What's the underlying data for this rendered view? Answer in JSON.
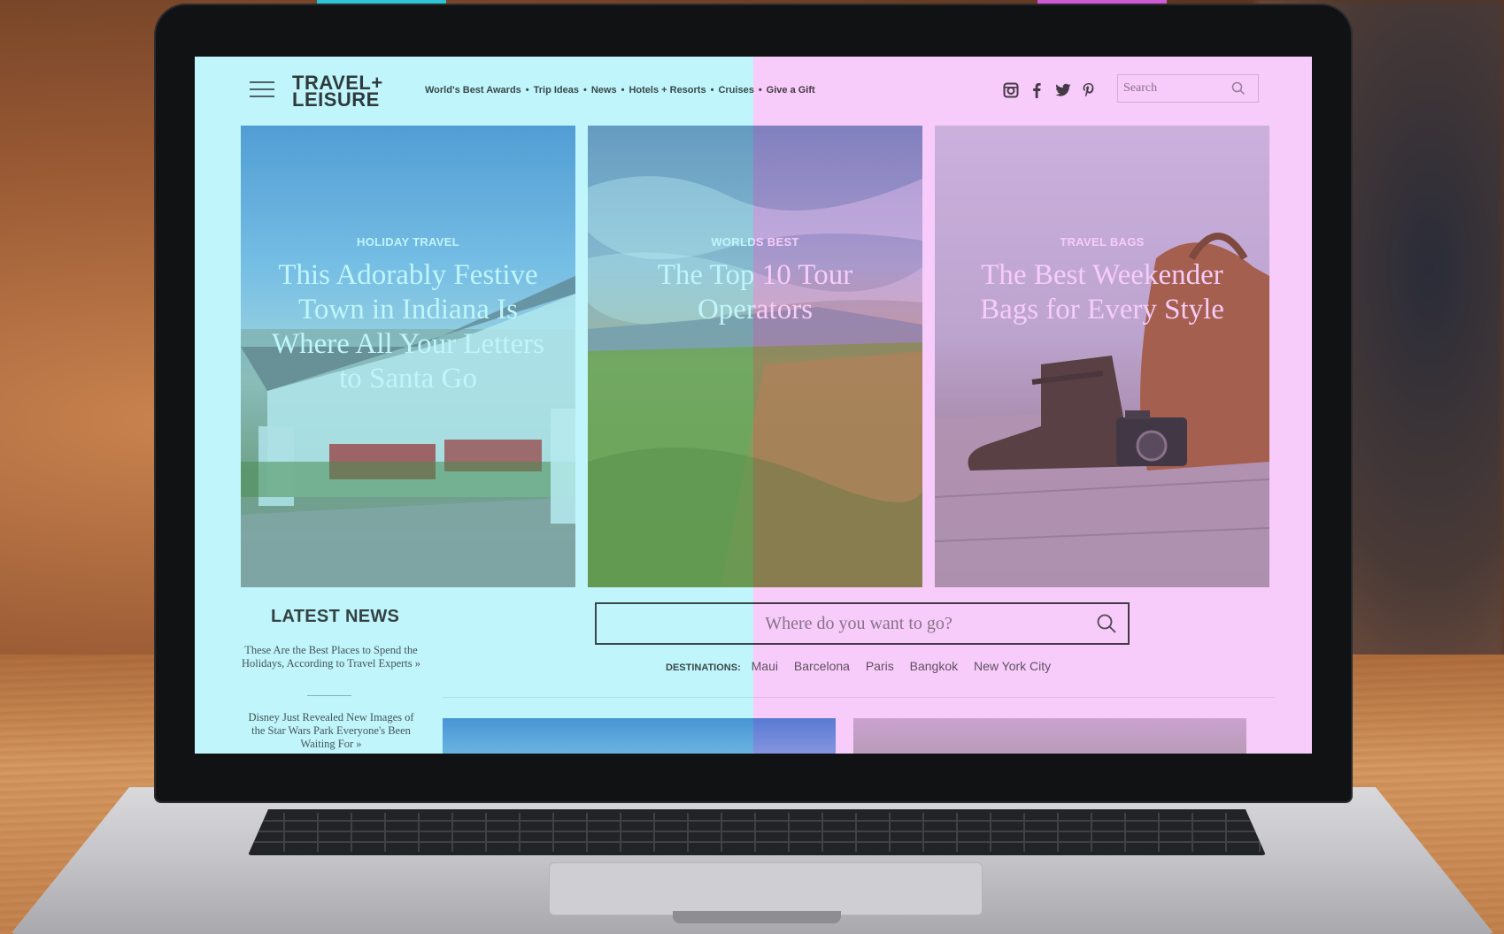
{
  "header": {
    "logo_line1": "TRAVEL+",
    "logo_line2": "LEISURE",
    "nav": [
      {
        "label": "World's Best Awards"
      },
      {
        "label": "Trip Ideas"
      },
      {
        "label": "News"
      },
      {
        "label": "Hotels + Resorts"
      },
      {
        "label": "Cruises"
      },
      {
        "label": "Give a Gift"
      }
    ],
    "nav_separator": "•",
    "social_icons": [
      "instagram-icon",
      "facebook-icon",
      "twitter-icon",
      "pinterest-icon"
    ],
    "search_placeholder": "Search"
  },
  "cards": [
    {
      "kicker": "HOLIDAY TRAVEL",
      "headline": "This Adorably Festive Town in Indiana Is Where All Your Letters to Santa Go"
    },
    {
      "kicker": "WORLDS BEST",
      "headline": "The Top 10 Tour Operators"
    },
    {
      "kicker": "TRAVEL BAGS",
      "headline": "The Best Weekender Bags for Every Style"
    }
  ],
  "latest_news": {
    "title": "LATEST NEWS",
    "items": [
      {
        "text": "These Are the Best Places to Spend the Holidays, According to Travel Experts »"
      },
      {
        "text": "Disney Just Revealed New Images of the Star Wars Park Everyone's Been Waiting For »"
      }
    ]
  },
  "main_search": {
    "placeholder": "Where do you want to go?"
  },
  "destinations": {
    "label": "DESTINATIONS:",
    "items": [
      "Maui",
      "Barcelona",
      "Paris",
      "Bangkok",
      "New York City"
    ]
  },
  "colors": {
    "left_tint": "#00d7eb",
    "right_tint": "#e150eb",
    "top_strip_left": "#2ec4d8",
    "top_strip_right": "#d05ad8"
  }
}
